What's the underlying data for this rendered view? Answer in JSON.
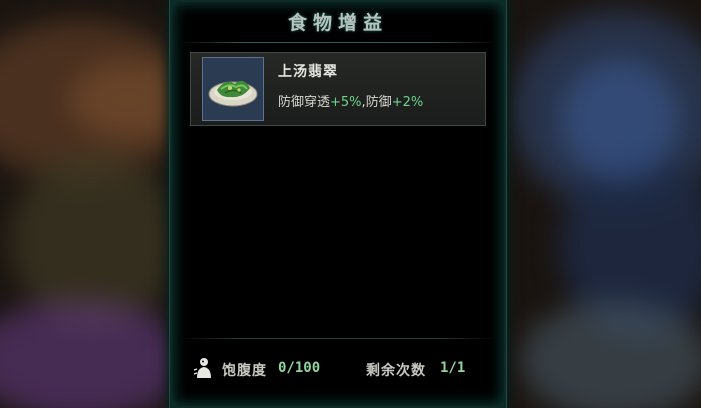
{
  "panel": {
    "title": "食物增益"
  },
  "buff": {
    "food_name": "上汤翡翠",
    "effect_1_label": "防御穿透",
    "effect_1_value": "+5%",
    "separator": ",",
    "effect_2_label": "防御",
    "effect_2_value": "+2%",
    "thumb_icon": "food-dish-icon"
  },
  "footer": {
    "satiety_label": "饱腹度",
    "satiety_value": "0/100",
    "remaining_label": "剩余次数",
    "remaining_value": "1/1",
    "satiety_icon": "satiety-icon"
  },
  "colors": {
    "bonus_green": "#6fd38a",
    "value_green": "#8fd69e",
    "panel_border": "#1d4a43"
  }
}
